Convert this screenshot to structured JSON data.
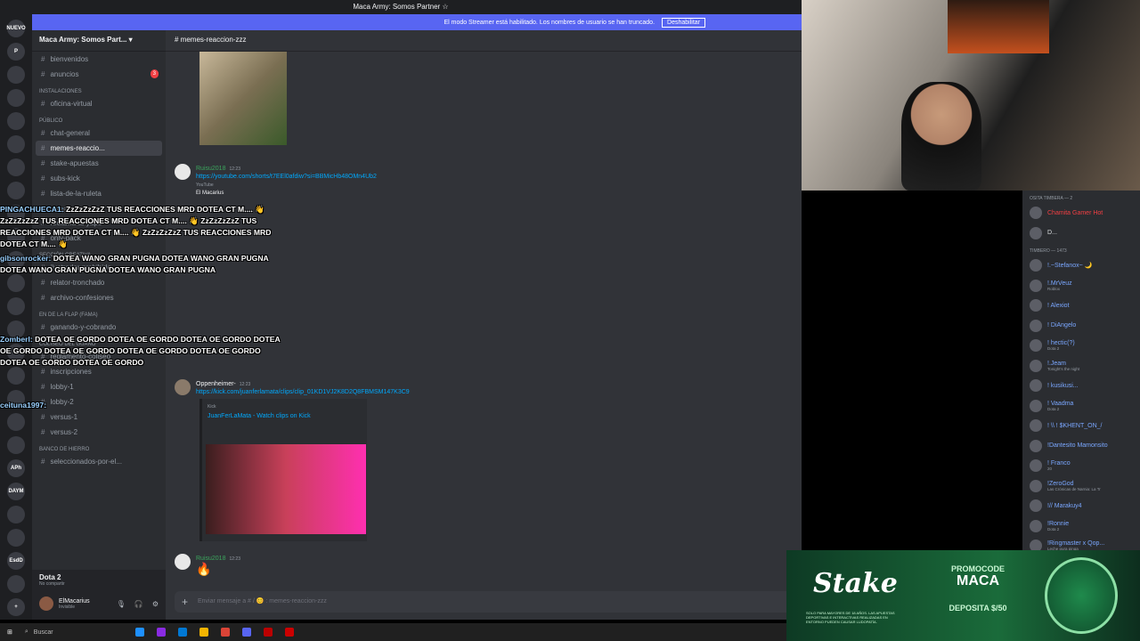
{
  "window": {
    "title": "Maca Army: Somos Partner ☆"
  },
  "streamer_bar": {
    "text": "El modo Streamer está habilitado. Los nombres de usuario se han truncado.",
    "button": "Deshabilitar"
  },
  "servers": [
    "NUEVO",
    "P",
    "",
    "",
    "",
    "",
    "",
    "",
    "",
    "",
    "",
    "",
    "",
    "",
    "",
    "",
    "",
    "",
    "",
    "APh",
    "DAYM",
    "",
    "",
    "EsdD",
    "",
    "+"
  ],
  "guild": {
    "name": "Maca Army: Somos Part..."
  },
  "channels": {
    "top": [
      {
        "name": "bienvenidos"
      },
      {
        "name": "anuncios",
        "badge": "3"
      }
    ],
    "cat_instalaciones": "INSTALACIONES",
    "instalaciones": [
      {
        "name": "oficina-virtual"
      }
    ],
    "cat_publico": "PÚBLICO",
    "publico": [
      {
        "name": "chat-general"
      },
      {
        "name": "memes-reaccio..."
      },
      {
        "name": "stake-apuestas"
      },
      {
        "name": "subs-kick"
      },
      {
        "name": "lista-de-la-ruleta"
      }
    ],
    "cat_tembleta": "AL TIMBERO",
    "tembleta": [
      {
        "name": "reclama-tu-yape"
      },
      {
        "name": "only-pack"
      }
    ],
    "cat_creativa": "SECCIÓN CREATIVA",
    "creativa": [
      {
        "name": "ilustrador-prohibido"
      },
      {
        "name": "relator-tronchado"
      },
      {
        "name": "archivo-confesiones"
      }
    ],
    "cat_fama": "EN DE LA FLAP (FAMA)",
    "fama": [
      {
        "name": "ganando-y-cobrando"
      }
    ],
    "cat_coliseo": "COLISEO DEL GUANO",
    "coliseo": [
      {
        "name": "reglamento-coliseo"
      },
      {
        "name": "inscripciones"
      },
      {
        "name": "lobby-1"
      },
      {
        "name": "lobby-2"
      },
      {
        "name": "versus-1"
      },
      {
        "name": "versus-2"
      }
    ],
    "cat_hierro": "BANCO DE HIERRO",
    "hierro": [
      {
        "name": "seleccionados-por-el..."
      }
    ]
  },
  "voice": {
    "title": "Dota 2",
    "status": "No compartir"
  },
  "me": {
    "name": "ElMacarius",
    "status": "Invisible"
  },
  "chat": {
    "channel": "memes-reaccion-zzz",
    "messages": [
      {
        "user": "Ruisu2018",
        "time": "12:23",
        "link": "https://youtube.com/shorts/t7EEl0afdiw?si=BBMicHb48OMn4Ub2",
        "embed_source": "YouTube",
        "embed_user": "El Macarius"
      },
      {
        "user": "Oppenheimer-",
        "time": "12:23",
        "link": "https://kick.com/juanferlamata/clips/clip_01KD1VJ2K8D2Q8FBMSM147K3C9",
        "embed_source": "Kick",
        "embed_title": "JuanFerLaMata - Watch clips on Kick"
      },
      {
        "user": "Ruisu2018",
        "time": "12:23",
        "text": "🔥"
      }
    ],
    "placeholder": "Enviar mensaje a # / 😊 : memes-reaccion-zzz"
  },
  "overlay": [
    {
      "name": "PINGACHUECA1:",
      "text": "ZzZzZzZzZ TUS REACCIONES MRD DOTEA CT M.... 👋 ZzZzZzZzZ TUS REACCIONES MRD DOTEA CT M.... 👋 ZzZzZzZzZ TUS REACCIONES MRD DOTEA CT M.... 👋 ZzZzZzZzZ TUS REACCIONES MRD DOTEA CT M.... 👋"
    },
    {
      "name": "gibsonrocker:",
      "text": "DOTEA WANO GRAN PUGNA DOTEA WANO GRAN PUGNA DOTEA WANO GRAN PUGNA DOTEA WANO GRAN PUGNA"
    },
    {
      "name": "Zomberl:",
      "text": "DOTEA OE GORDO DOTEA OE GORDO DOTEA OE GORDO DOTEA OE GORDO DOTEA OE GORDO DOTEA OE GORDO DOTEA OE GORDO DOTEA OE GORDO DOTEA OE GORDO"
    },
    {
      "name": "ceituna1997:",
      "text": ""
    }
  ],
  "members": {
    "cat1": "OSITA TIMBERA — 2",
    "group1": [
      {
        "name": "Chamita Gamer Hot",
        "color": "#f23f43"
      },
      {
        "name": "D...",
        "color": "#dbdee1"
      }
    ],
    "cat2": "TIMBERO — 1473",
    "group2": [
      {
        "name": "!.~Stefanox~ 🌙",
        "sub": "",
        "color": "#7aa7ff"
      },
      {
        "name": "!.MrVeuz",
        "sub": "Roblox",
        "color": "#7aa7ff"
      },
      {
        "name": "! Alexiot",
        "sub": "",
        "color": "#7aa7ff"
      },
      {
        "name": "! DiAngelo",
        "sub": "",
        "color": "#7aa7ff"
      },
      {
        "name": "! hectic(?)",
        "sub": "Dota 2",
        "color": "#7aa7ff"
      },
      {
        "name": "!.Jeam",
        "sub": "Tonight's the night",
        "color": "#7aa7ff"
      },
      {
        "name": "! kusikusi...",
        "sub": "",
        "color": "#7aa7ff"
      },
      {
        "name": "! Vaadma",
        "sub": "Dota 2",
        "color": "#7aa7ff"
      },
      {
        "name": "! \\\\ ! $KHENT_ON_/",
        "sub": "",
        "color": "#7aa7ff"
      },
      {
        "name": "!Dantesito Mamonsito",
        "sub": "",
        "color": "#7aa7ff"
      },
      {
        "name": "! Franco",
        "sub": "20",
        "color": "#7aa7ff"
      },
      {
        "name": "!ZeroGod",
        "sub": "Las Crónicas de Narnia: La Tr",
        "color": "#7aa7ff"
      },
      {
        "name": "!// Marakuy4",
        "sub": "",
        "color": "#7aa7ff"
      },
      {
        "name": "!Ronnie",
        "sub": "Dota 2",
        "color": "#7aa7ff"
      },
      {
        "name": "!Ringmaster x Qop...",
        "sub": "Leche pura pinga",
        "color": "#7aa7ff"
      }
    ]
  },
  "stake": {
    "logo": "Stake",
    "promo_line1": "PROMOCODE",
    "promo_line2": "MACA",
    "promo_line3": "DEPOSITA $/50",
    "fineprint": "SOLO PARA MAYORES DE 18 AÑOS. LAS APUESTAS DEPORTIVAS E INTERACTIVAS REALIZADAS EN ENTORNO PUEDEN CAUSAR LUDOPATÍA."
  },
  "taskbar": {
    "search": "Buscar"
  }
}
